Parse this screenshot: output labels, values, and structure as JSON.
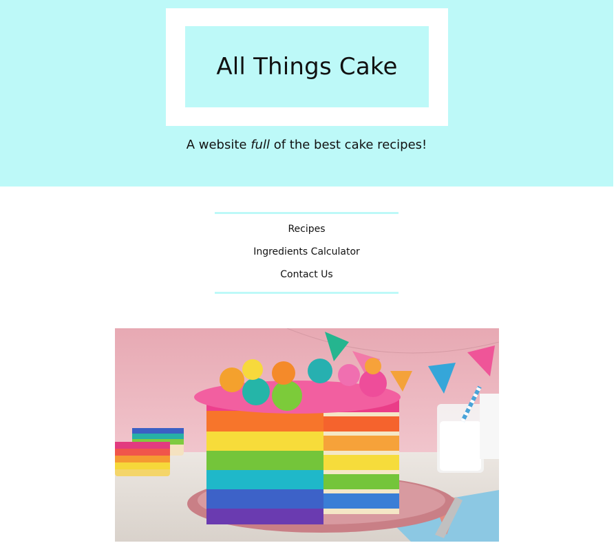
{
  "header": {
    "site_title": "All Things Cake",
    "tagline_before": "A website ",
    "tagline_emphasis": "full",
    "tagline_after": " of the best cake recipes!"
  },
  "nav": {
    "items": [
      {
        "label": "Recipes"
      },
      {
        "label": "Ingredients Calculator"
      },
      {
        "label": "Contact Us"
      }
    ]
  },
  "colors": {
    "header_background": "#bdf9f8",
    "divider": "#bdf9f8"
  },
  "hero": {
    "image_subject": "rainbow layer cake with sliced piece, candles and bunting"
  }
}
